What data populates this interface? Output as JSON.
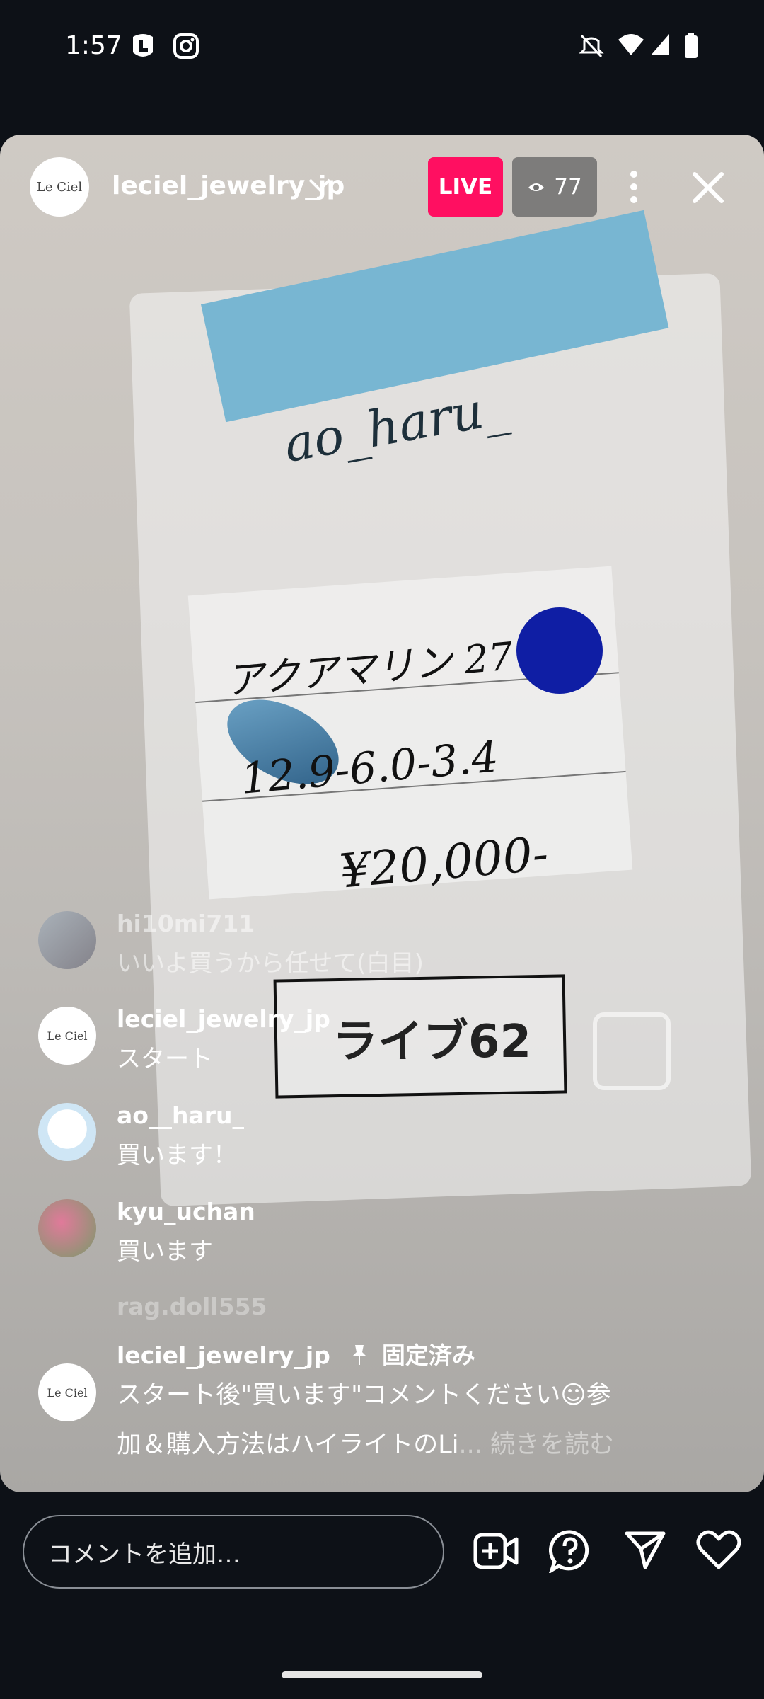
{
  "status_bar": {
    "time": "1:57"
  },
  "live_header": {
    "username": "leciel_jewelry_jp",
    "live_label": "LIVE",
    "viewer_count": "77",
    "avatar_text": "Le Ciel"
  },
  "video": {
    "note_text": "ao_haru_",
    "card_line1": "アクアマリン 27",
    "card_line2": "12.9-6.0-3.4",
    "card_price": "¥20,000-",
    "label_text": "ライブ62"
  },
  "comments": [
    {
      "user": "hi10mi711",
      "text": "いいよ買うから任せて(白目)"
    },
    {
      "user": "leciel_jewelry_jp",
      "text": "スタート"
    },
    {
      "user": "ao__haru_",
      "text": "買います！"
    },
    {
      "user": "kyu_uchan",
      "text": "買います"
    },
    {
      "user": "rag.doll555",
      "text": ""
    }
  ],
  "pinned": {
    "user": "leciel_jewelry_jp",
    "pin_label": "固定済み",
    "line1": "スタート後\"買います\"コメントください☺参",
    "line2": "加＆購入方法はハイライトのLi",
    "more": "... 続きを読む"
  },
  "bottom_bar": {
    "comment_placeholder": "コメントを追加…"
  }
}
